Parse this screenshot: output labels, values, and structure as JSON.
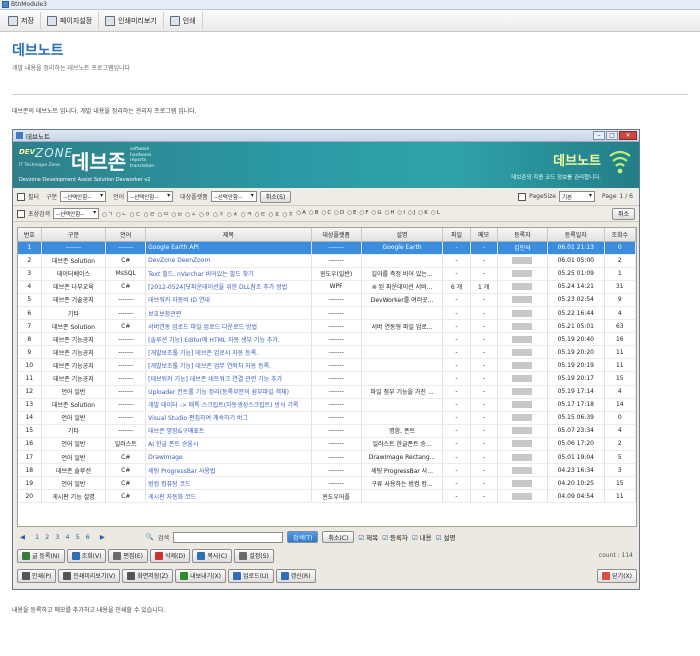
{
  "window": {
    "title": "BtnModule3"
  },
  "outer_toolbar": [
    {
      "label": "저장",
      "icon": "save-icon"
    },
    {
      "label": "페이지설정",
      "icon": "page-setup-icon"
    },
    {
      "label": "인쇄미리보기",
      "icon": "print-preview-icon"
    },
    {
      "label": "인쇄",
      "icon": "print-icon"
    }
  ],
  "page": {
    "title": "데브노트",
    "subtitle": "개발 내용을 정리하는 데브노트 프로그램입니다",
    "description": "데브존의 데브노트 입니다. 개발 내용을 정리하는 관리자 프로그램 입니다.",
    "footer_note": "내용을 등록하고 메모를 추가하고 내용을 인쇄할 수 있습니다."
  },
  "app": {
    "title": "데브노트",
    "banner": {
      "dev": "DEV",
      "zone": "ZONE",
      "zone_sub": "IT Technique Zone",
      "brand": "데브존",
      "stack": [
        "software",
        "hardware",
        "reports",
        "translation"
      ],
      "tagline": "Devzone Development Assist Solution Devworker v2",
      "module_title": "데브노트",
      "module_sub": "데브존의 각종 코드 정보를 관리합니다."
    },
    "filter": {
      "filter_label": "필터",
      "category_label": "구분",
      "category_value": "--선택안함--",
      "language_label": "언어",
      "language_value": "--선택안함--",
      "target_label": "대상플랫폼",
      "target_value": "--선택안함--",
      "cancel_label": "취소(S)",
      "pagesize_label": "PageSize",
      "pagesize_value": "기본",
      "page_label": "Page",
      "page_value": "1 / 6"
    },
    "initial": {
      "label": "초성검색",
      "value": "--선택안함--",
      "letters": [
        "ㄱ",
        "ㄴ",
        "ㄷ",
        "ㄹ",
        "ㅁ",
        "ㅂ",
        "ㅅ",
        "ㅇ",
        "ㅈ",
        "ㅊ",
        "ㅋ",
        "ㅌ",
        "ㅍ",
        "ㅎ",
        "A",
        "B",
        "C",
        "D",
        "E",
        "F",
        "G",
        "H",
        "I",
        "J",
        "K",
        "L"
      ],
      "cancel_label": "취소"
    },
    "columns": [
      "번호",
      "구분",
      "언어",
      "제목",
      "대상플랫폼",
      "설명",
      "파일",
      "메모",
      "등록자",
      "등록일자",
      "조회수"
    ],
    "rows": [
      [
        "1",
        "-------",
        "-------",
        "Google Earth API",
        "-------",
        "Google Earth",
        "-",
        "-",
        "김인석",
        "06.01 21:13",
        "0"
      ],
      [
        "2",
        "데브존 Solution",
        "C#",
        "DevZone DeenZoom",
        "-------",
        "",
        "-",
        "-",
        "",
        "06.01 05:00",
        "2"
      ],
      [
        "3",
        "데이터베이스",
        "MsSQL",
        "Text 필드, nVarchar 비어있는 필드 찾기",
        "윈도우(일반)",
        "길이를 측정 비어 있는...",
        "-",
        "-",
        "",
        "05.25 01:09",
        "1"
      ],
      [
        "4",
        "데브존 나부교육",
        "C#",
        "[2012-0524]닷파운데이션을 위한 DLL참조 추가 방법",
        "WPF",
        "※ 된 파운데이션 서비...",
        "6 개",
        "1 개",
        "",
        "05.24 14:21",
        "31"
      ],
      [
        "5",
        "데브존 기술공지",
        "-------",
        "데브워커 자동비 ID 연대",
        "-------",
        "DevWorker를 여러곳...",
        "-",
        "-",
        "",
        "05.23 02:54",
        "9"
      ],
      [
        "6",
        "기타",
        "-------",
        "보호보장관련",
        "-------",
        "",
        "-",
        "-",
        "",
        "05.22 16:44",
        "4"
      ],
      [
        "7",
        "데브존 Solution",
        "C#",
        "서버연동 업로드 파일 업로드 다운로드 방법",
        "-------",
        "서버 연동형 파일 업로...",
        "-",
        "-",
        "",
        "05.21 05:01",
        "63"
      ],
      [
        "8",
        "데브존 기능공지",
        "-------",
        "[솔루션 기능] Editor에 HTML 자동 생부 기능 추가.",
        "-------",
        "",
        "-",
        "-",
        "",
        "05.19 20:40",
        "16"
      ],
      [
        "9",
        "데브존 기능공지",
        "-------",
        "[개발보조툴 기능] 데브존 업로서 자동 등록.",
        "-------",
        "",
        "-",
        "-",
        "",
        "05.19 20:20",
        "11"
      ],
      [
        "10",
        "데브존 기능공지",
        "-------",
        "[개발보조툴 기능] 데브존 업무 연락처 자동 등록.",
        "-------",
        "",
        "-",
        "-",
        "",
        "05.19 20:19",
        "11"
      ],
      [
        "11",
        "데브존 기능공지",
        "-------",
        "[데브워커 기능] 데브존 네트워크 연결 관련 기능 추가",
        "-------",
        "",
        "-",
        "-",
        "",
        "05.19 20:17",
        "15"
      ],
      [
        "12",
        "언어 일반",
        "-------",
        "Uploader 컨트롤 기능 정리(등록부분의 쉼부파일 객체)",
        "-------",
        "파일 첨부 기능을 가진 ...",
        "-",
        "-",
        "",
        "05.19 17:14",
        "4"
      ],
      [
        "13",
        "데브존 Solution",
        "-------",
        "개발 데이터 -> 매톡 스크립트(자동생성스크립트) 방식 기록",
        "-------",
        "",
        "-",
        "-",
        "",
        "05.17 17:18",
        "14"
      ],
      [
        "14",
        "언어 일반",
        "-------",
        "Visual Studio 편집하여 계속하기 버그",
        "-------",
        "",
        "-",
        "-",
        "",
        "05.15 06:39",
        "0"
      ],
      [
        "15",
        "기타",
        "-------",
        "데브존 명함&구매표트",
        "-------",
        "명함, 폰트",
        "-",
        "-",
        "",
        "05.07 23:34",
        "4"
      ],
      [
        "16",
        "언어 일반",
        "일러스트",
        "AI 한글 폰트 승움시",
        "-------",
        "일러스트 한글폰트 승...",
        "-",
        "-",
        "",
        "05.06 17:20",
        "2"
      ],
      [
        "17",
        "언어 일반",
        "C#",
        "DrawImage",
        "-------",
        "DrawImage Rectang...",
        "-",
        "-",
        "",
        "05.01 19:04",
        "5"
      ],
      [
        "18",
        "데브존 솔루션",
        "C#",
        "세팅 ProgressBar 사용법",
        "-------",
        "세팅 ProgressBar 사...",
        "-",
        "-",
        "",
        "04.23 16:34",
        "3"
      ],
      [
        "19",
        "언어 일반",
        "C#",
        "범컴 컴퓨팅 코드",
        "-------",
        "구류 사용하는 범컴 컴...",
        "-",
        "-",
        "",
        "04.20 10:25",
        "15"
      ],
      [
        "20",
        "게시판 기능 설명",
        "C#",
        "게시판 자동화 코드",
        "윈도우어플",
        "",
        "-",
        "-",
        "",
        "04.09 04:54",
        "11"
      ]
    ],
    "pager": {
      "pages": [
        "1",
        "2",
        "3",
        "4",
        "5",
        "6"
      ],
      "search_label": "검색",
      "search_btn": "검색(T)",
      "cancel_btn": "취소(C)",
      "checks": [
        "제목",
        "등록자",
        "내용",
        "설명"
      ]
    },
    "actions": [
      {
        "label": "글 등록(N)",
        "icon": "add-icon",
        "color": "#3c7a3c"
      },
      {
        "label": "조회(V)",
        "icon": "view-icon",
        "color": "#2f6eb7"
      },
      {
        "label": "편집(E)",
        "icon": "edit-icon",
        "color": "#6b6b6b"
      },
      {
        "label": "삭제(D)",
        "icon": "delete-icon",
        "color": "#c8332b"
      },
      {
        "label": "복사(C)",
        "icon": "copy-icon",
        "color": "#2f6eb7"
      },
      {
        "label": "설정(S)",
        "icon": "settings-icon",
        "color": "#6b6b6b"
      }
    ],
    "count": "count : 114",
    "bottom_actions": [
      {
        "label": "인쇄(P)",
        "icon": "print-icon",
        "color": "#555555"
      },
      {
        "label": "인쇄미리보기(V)",
        "icon": "print-preview-icon",
        "color": "#555555"
      },
      {
        "label": "화면저장(Z)",
        "icon": "screen-save-icon",
        "color": "#555555"
      },
      {
        "label": "내보내기(X)",
        "icon": "export-icon",
        "color": "#2f8a2f"
      },
      {
        "label": "업로드(U)",
        "icon": "upload-icon",
        "color": "#2f6eb7"
      },
      {
        "label": "갱신(R)",
        "icon": "refresh-icon",
        "color": "#2f6eb7"
      }
    ],
    "close_label": "닫기(X)"
  }
}
